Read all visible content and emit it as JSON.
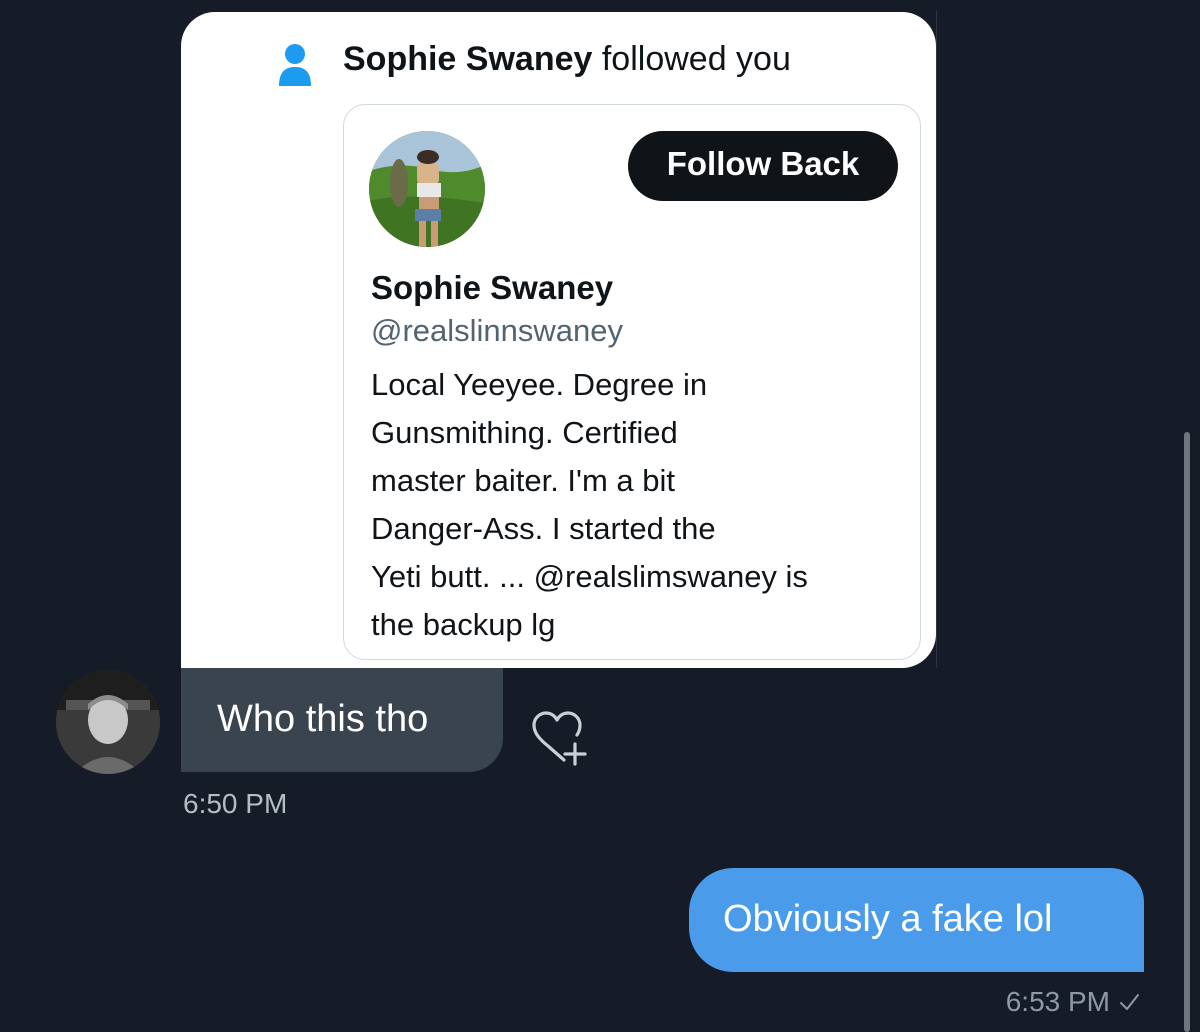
{
  "notification": {
    "name": "Sophie Swaney",
    "action_text": " followed you",
    "icon": "person-icon"
  },
  "profile_card": {
    "follow_button_label": "Follow Back",
    "display_name": "Sophie Swaney",
    "handle": "@realslinnswaney",
    "bio_lines": [
      "Local Yeeyee. Degree in",
      "Gunsmithing. Certified",
      "master baiter. I'm a bit",
      "Danger-Ass. I started the",
      "Yeti butt. ... @realslimswaney is",
      "the backup lg"
    ]
  },
  "messages": {
    "incoming": {
      "text": "Who this tho",
      "time": "6:50 PM",
      "reaction_icon": "add-reaction-heart-icon"
    },
    "outgoing": {
      "text": "Obviously a fake lol",
      "time": "6:53 PM",
      "status_icon": "sent-check-icon"
    }
  },
  "colors": {
    "background": "#151c27",
    "incoming_bubble": "#3a444f",
    "outgoing_bubble": "#4a9cea",
    "follow_button": "#0f1419",
    "notify_icon": "#1d9bf0"
  }
}
